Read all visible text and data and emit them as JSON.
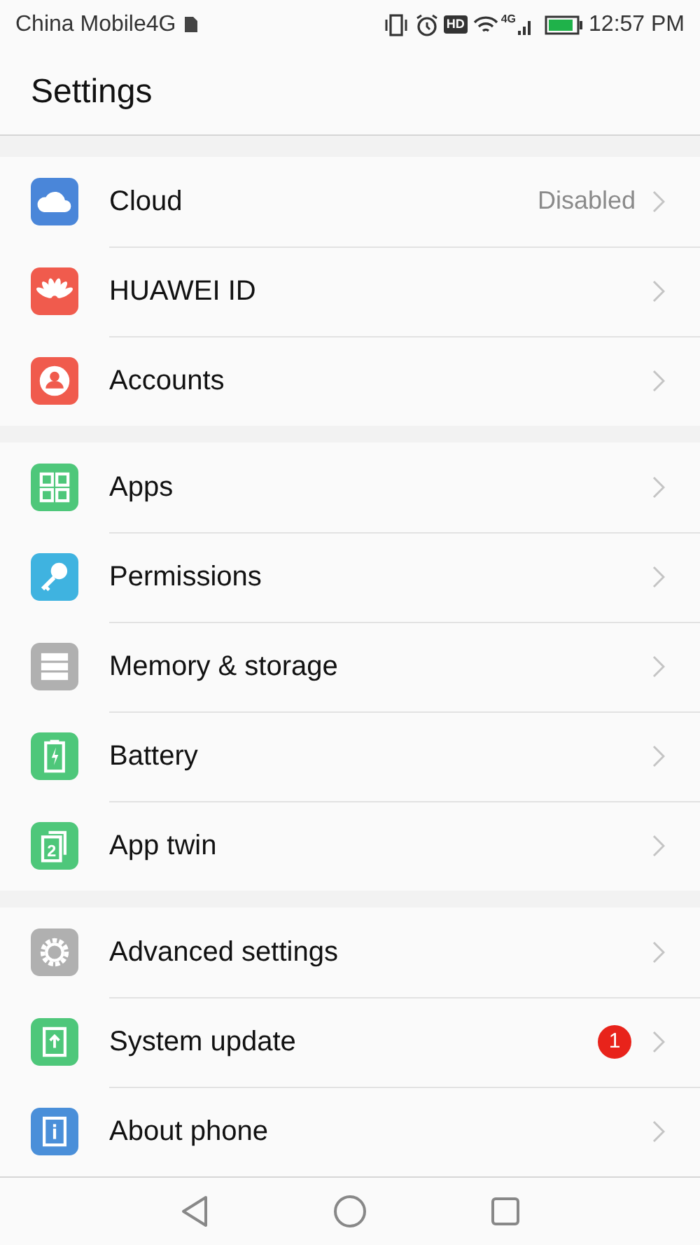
{
  "status_bar": {
    "carrier": "China Mobile4G",
    "network": "4G",
    "hd_label": "HD",
    "time": "12:57 PM"
  },
  "header": {
    "title": "Settings"
  },
  "groups": [
    {
      "items": [
        {
          "kind": "cloud",
          "color": "#4a86d9",
          "label": "Cloud",
          "value": "Disabled"
        },
        {
          "kind": "flower",
          "color": "#f05b4d",
          "label": "HUAWEI ID"
        },
        {
          "kind": "person",
          "color": "#f05b4d",
          "label": "Accounts"
        }
      ]
    },
    {
      "items": [
        {
          "kind": "grid",
          "color": "#4ec77a",
          "label": "Apps"
        },
        {
          "kind": "key",
          "color": "#3fb3e0",
          "label": "Permissions"
        },
        {
          "kind": "storage",
          "color": "#b0b0b0",
          "label": "Memory & storage"
        },
        {
          "kind": "battery",
          "color": "#4ec77a",
          "label": "Battery"
        },
        {
          "kind": "twin",
          "color": "#4ec77a",
          "label": "App twin",
          "twin_digit": "2"
        }
      ]
    },
    {
      "items": [
        {
          "kind": "gear",
          "color": "#b0b0b0",
          "label": "Advanced settings"
        },
        {
          "kind": "update",
          "color": "#4ec77a",
          "label": "System update",
          "badge": "1"
        },
        {
          "kind": "info",
          "color": "#4a8fd9",
          "label": "About phone"
        }
      ]
    }
  ],
  "nav_bar": {
    "buttons": [
      {
        "kind": "back"
      },
      {
        "kind": "home"
      },
      {
        "kind": "recents"
      }
    ]
  }
}
